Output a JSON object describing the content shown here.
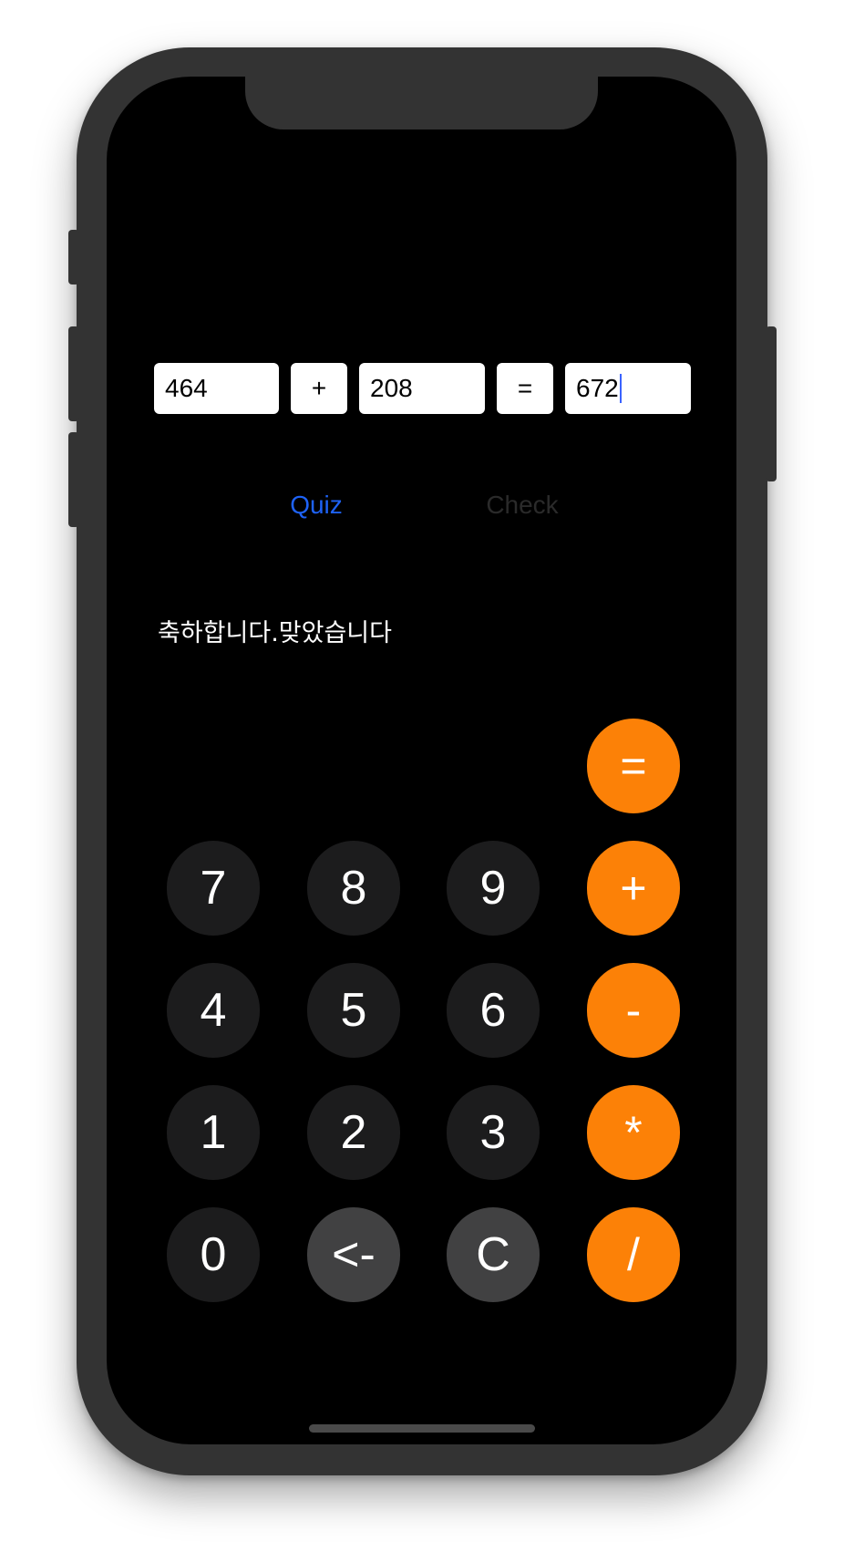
{
  "equation": {
    "operand1": "464",
    "operator": "+",
    "operand2": "208",
    "equals": "=",
    "answer": "672"
  },
  "actions": {
    "quiz_label": "Quiz",
    "check_label": "Check"
  },
  "result_message": "축하합니다.맞았습니다",
  "keypad": {
    "equals": "=",
    "plus": "+",
    "minus": "-",
    "multiply": "*",
    "divide": "/",
    "seven": "7",
    "eight": "8",
    "nine": "9",
    "four": "4",
    "five": "5",
    "six": "6",
    "one": "1",
    "two": "2",
    "three": "3",
    "zero": "0",
    "backspace": "<-",
    "clear": "C"
  },
  "colors": {
    "accent_orange": "#fc8107",
    "link_blue": "#1e62f6",
    "disabled_text": "#2a2a2a",
    "digit_key": "#1c1c1d",
    "function_key": "#414142"
  }
}
